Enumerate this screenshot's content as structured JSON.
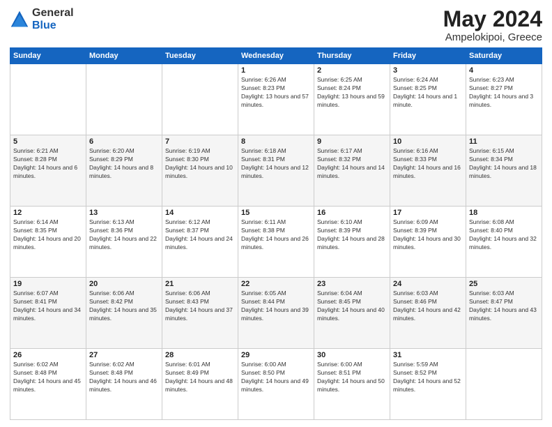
{
  "header": {
    "logo": {
      "line1": "General",
      "line2": "Blue"
    },
    "title": "May 2024",
    "subtitle": "Ampelokipoi, Greece"
  },
  "calendar": {
    "days_of_week": [
      "Sunday",
      "Monday",
      "Tuesday",
      "Wednesday",
      "Thursday",
      "Friday",
      "Saturday"
    ],
    "weeks": [
      [
        {
          "day": "",
          "info": ""
        },
        {
          "day": "",
          "info": ""
        },
        {
          "day": "",
          "info": ""
        },
        {
          "day": "1",
          "sunrise": "Sunrise: 6:26 AM",
          "sunset": "Sunset: 8:23 PM",
          "daylight": "Daylight: 13 hours and 57 minutes."
        },
        {
          "day": "2",
          "sunrise": "Sunrise: 6:25 AM",
          "sunset": "Sunset: 8:24 PM",
          "daylight": "Daylight: 13 hours and 59 minutes."
        },
        {
          "day": "3",
          "sunrise": "Sunrise: 6:24 AM",
          "sunset": "Sunset: 8:25 PM",
          "daylight": "Daylight: 14 hours and 1 minute."
        },
        {
          "day": "4",
          "sunrise": "Sunrise: 6:23 AM",
          "sunset": "Sunset: 8:27 PM",
          "daylight": "Daylight: 14 hours and 3 minutes."
        }
      ],
      [
        {
          "day": "5",
          "sunrise": "Sunrise: 6:21 AM",
          "sunset": "Sunset: 8:28 PM",
          "daylight": "Daylight: 14 hours and 6 minutes."
        },
        {
          "day": "6",
          "sunrise": "Sunrise: 6:20 AM",
          "sunset": "Sunset: 8:29 PM",
          "daylight": "Daylight: 14 hours and 8 minutes."
        },
        {
          "day": "7",
          "sunrise": "Sunrise: 6:19 AM",
          "sunset": "Sunset: 8:30 PM",
          "daylight": "Daylight: 14 hours and 10 minutes."
        },
        {
          "day": "8",
          "sunrise": "Sunrise: 6:18 AM",
          "sunset": "Sunset: 8:31 PM",
          "daylight": "Daylight: 14 hours and 12 minutes."
        },
        {
          "day": "9",
          "sunrise": "Sunrise: 6:17 AM",
          "sunset": "Sunset: 8:32 PM",
          "daylight": "Daylight: 14 hours and 14 minutes."
        },
        {
          "day": "10",
          "sunrise": "Sunrise: 6:16 AM",
          "sunset": "Sunset: 8:33 PM",
          "daylight": "Daylight: 14 hours and 16 minutes."
        },
        {
          "day": "11",
          "sunrise": "Sunrise: 6:15 AM",
          "sunset": "Sunset: 8:34 PM",
          "daylight": "Daylight: 14 hours and 18 minutes."
        }
      ],
      [
        {
          "day": "12",
          "sunrise": "Sunrise: 6:14 AM",
          "sunset": "Sunset: 8:35 PM",
          "daylight": "Daylight: 14 hours and 20 minutes."
        },
        {
          "day": "13",
          "sunrise": "Sunrise: 6:13 AM",
          "sunset": "Sunset: 8:36 PM",
          "daylight": "Daylight: 14 hours and 22 minutes."
        },
        {
          "day": "14",
          "sunrise": "Sunrise: 6:12 AM",
          "sunset": "Sunset: 8:37 PM",
          "daylight": "Daylight: 14 hours and 24 minutes."
        },
        {
          "day": "15",
          "sunrise": "Sunrise: 6:11 AM",
          "sunset": "Sunset: 8:38 PM",
          "daylight": "Daylight: 14 hours and 26 minutes."
        },
        {
          "day": "16",
          "sunrise": "Sunrise: 6:10 AM",
          "sunset": "Sunset: 8:39 PM",
          "daylight": "Daylight: 14 hours and 28 minutes."
        },
        {
          "day": "17",
          "sunrise": "Sunrise: 6:09 AM",
          "sunset": "Sunset: 8:39 PM",
          "daylight": "Daylight: 14 hours and 30 minutes."
        },
        {
          "day": "18",
          "sunrise": "Sunrise: 6:08 AM",
          "sunset": "Sunset: 8:40 PM",
          "daylight": "Daylight: 14 hours and 32 minutes."
        }
      ],
      [
        {
          "day": "19",
          "sunrise": "Sunrise: 6:07 AM",
          "sunset": "Sunset: 8:41 PM",
          "daylight": "Daylight: 14 hours and 34 minutes."
        },
        {
          "day": "20",
          "sunrise": "Sunrise: 6:06 AM",
          "sunset": "Sunset: 8:42 PM",
          "daylight": "Daylight: 14 hours and 35 minutes."
        },
        {
          "day": "21",
          "sunrise": "Sunrise: 6:06 AM",
          "sunset": "Sunset: 8:43 PM",
          "daylight": "Daylight: 14 hours and 37 minutes."
        },
        {
          "day": "22",
          "sunrise": "Sunrise: 6:05 AM",
          "sunset": "Sunset: 8:44 PM",
          "daylight": "Daylight: 14 hours and 39 minutes."
        },
        {
          "day": "23",
          "sunrise": "Sunrise: 6:04 AM",
          "sunset": "Sunset: 8:45 PM",
          "daylight": "Daylight: 14 hours and 40 minutes."
        },
        {
          "day": "24",
          "sunrise": "Sunrise: 6:03 AM",
          "sunset": "Sunset: 8:46 PM",
          "daylight": "Daylight: 14 hours and 42 minutes."
        },
        {
          "day": "25",
          "sunrise": "Sunrise: 6:03 AM",
          "sunset": "Sunset: 8:47 PM",
          "daylight": "Daylight: 14 hours and 43 minutes."
        }
      ],
      [
        {
          "day": "26",
          "sunrise": "Sunrise: 6:02 AM",
          "sunset": "Sunset: 8:48 PM",
          "daylight": "Daylight: 14 hours and 45 minutes."
        },
        {
          "day": "27",
          "sunrise": "Sunrise: 6:02 AM",
          "sunset": "Sunset: 8:48 PM",
          "daylight": "Daylight: 14 hours and 46 minutes."
        },
        {
          "day": "28",
          "sunrise": "Sunrise: 6:01 AM",
          "sunset": "Sunset: 8:49 PM",
          "daylight": "Daylight: 14 hours and 48 minutes."
        },
        {
          "day": "29",
          "sunrise": "Sunrise: 6:00 AM",
          "sunset": "Sunset: 8:50 PM",
          "daylight": "Daylight: 14 hours and 49 minutes."
        },
        {
          "day": "30",
          "sunrise": "Sunrise: 6:00 AM",
          "sunset": "Sunset: 8:51 PM",
          "daylight": "Daylight: 14 hours and 50 minutes."
        },
        {
          "day": "31",
          "sunrise": "Sunrise: 5:59 AM",
          "sunset": "Sunset: 8:52 PM",
          "daylight": "Daylight: 14 hours and 52 minutes."
        },
        {
          "day": "",
          "info": ""
        }
      ]
    ]
  }
}
